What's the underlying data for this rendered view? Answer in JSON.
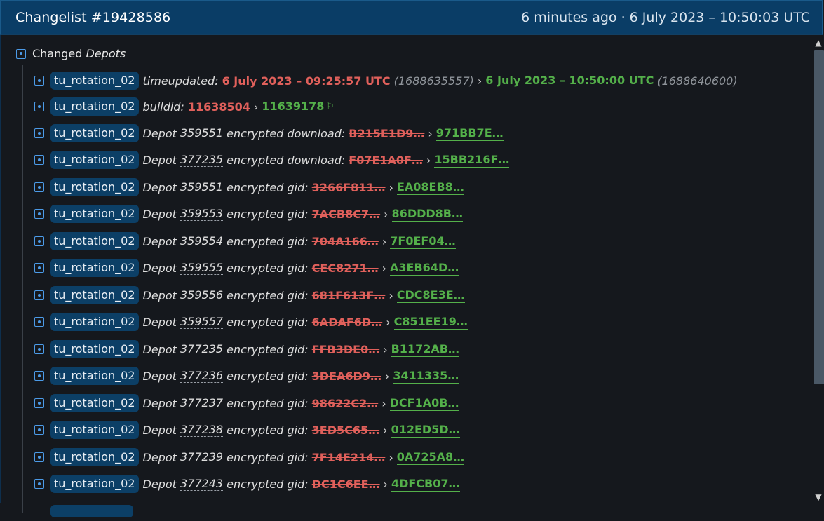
{
  "header": {
    "title": "Changelist #19428586",
    "meta": "6 minutes ago · 6 July 2023 – 10:50:03 UTC"
  },
  "section": {
    "prefix": "Changed",
    "name": "Depots"
  },
  "rows": [
    {
      "branch": "tu_rotation_02",
      "key": "timeupdated:",
      "old": "6 July 2023 – 09:25:57 UTC",
      "old_paren": "(1688635557)",
      "new": "6 July 2023 – 10:50:00 UTC",
      "new_paren": "(1688640600)"
    },
    {
      "branch": "tu_rotation_02",
      "key": "buildid:",
      "old": "11638504",
      "new": "11639178",
      "flag": "⚐"
    },
    {
      "branch": "tu_rotation_02",
      "pre": "Depot",
      "depot": "359551",
      "key": "encrypted download:",
      "old": "B215E1D9…",
      "new": "971BB7E…"
    },
    {
      "branch": "tu_rotation_02",
      "pre": "Depot",
      "depot": "377235",
      "key": "encrypted download:",
      "old": "F07E1A0F…",
      "new": "15BB216F…"
    },
    {
      "branch": "tu_rotation_02",
      "pre": "Depot",
      "depot": "359551",
      "key": "encrypted gid:",
      "old": "3266F811…",
      "new": "EA08EB8…"
    },
    {
      "branch": "tu_rotation_02",
      "pre": "Depot",
      "depot": "359553",
      "key": "encrypted gid:",
      "old": "7ACB8C7…",
      "new": "86DDD8B…"
    },
    {
      "branch": "tu_rotation_02",
      "pre": "Depot",
      "depot": "359554",
      "key": "encrypted gid:",
      "old": "704A166…",
      "new": "7F0EF04…"
    },
    {
      "branch": "tu_rotation_02",
      "pre": "Depot",
      "depot": "359555",
      "key": "encrypted gid:",
      "old": "CEC8271…",
      "new": "A3EB64D…"
    },
    {
      "branch": "tu_rotation_02",
      "pre": "Depot",
      "depot": "359556",
      "key": "encrypted gid:",
      "old": "681F613F…",
      "new": "CDC8E3E…"
    },
    {
      "branch": "tu_rotation_02",
      "pre": "Depot",
      "depot": "359557",
      "key": "encrypted gid:",
      "old": "6ADAF6D…",
      "new": "C851EE19…"
    },
    {
      "branch": "tu_rotation_02",
      "pre": "Depot",
      "depot": "377235",
      "key": "encrypted gid:",
      "old": "FFB3DE0…",
      "new": "B1172AB…"
    },
    {
      "branch": "tu_rotation_02",
      "pre": "Depot",
      "depot": "377236",
      "key": "encrypted gid:",
      "old": "3DEA6D9…",
      "new": "3411335…"
    },
    {
      "branch": "tu_rotation_02",
      "pre": "Depot",
      "depot": "377237",
      "key": "encrypted gid:",
      "old": "98622C2…",
      "new": "DCF1A0B…"
    },
    {
      "branch": "tu_rotation_02",
      "pre": "Depot",
      "depot": "377238",
      "key": "encrypted gid:",
      "old": "3ED5C65…",
      "new": "012ED5D…"
    },
    {
      "branch": "tu_rotation_02",
      "pre": "Depot",
      "depot": "377239",
      "key": "encrypted gid:",
      "old": "7F14E214…",
      "new": "0A725A8…"
    },
    {
      "branch": "tu_rotation_02",
      "pre": "Depot",
      "depot": "377243",
      "key": "encrypted gid:",
      "old": "DC1C6EE…",
      "new": "4DFCB07…"
    }
  ],
  "icons": {
    "row": "expand-box-icon",
    "scroll_up": "chevron-up-icon",
    "scroll_down": "chevron-down-icon"
  },
  "colors": {
    "header_bg": "#0a3d66",
    "badge_bg": "#0c3f66",
    "old": "#e0605b",
    "new": "#54b04a",
    "accent": "#4c9be8"
  }
}
